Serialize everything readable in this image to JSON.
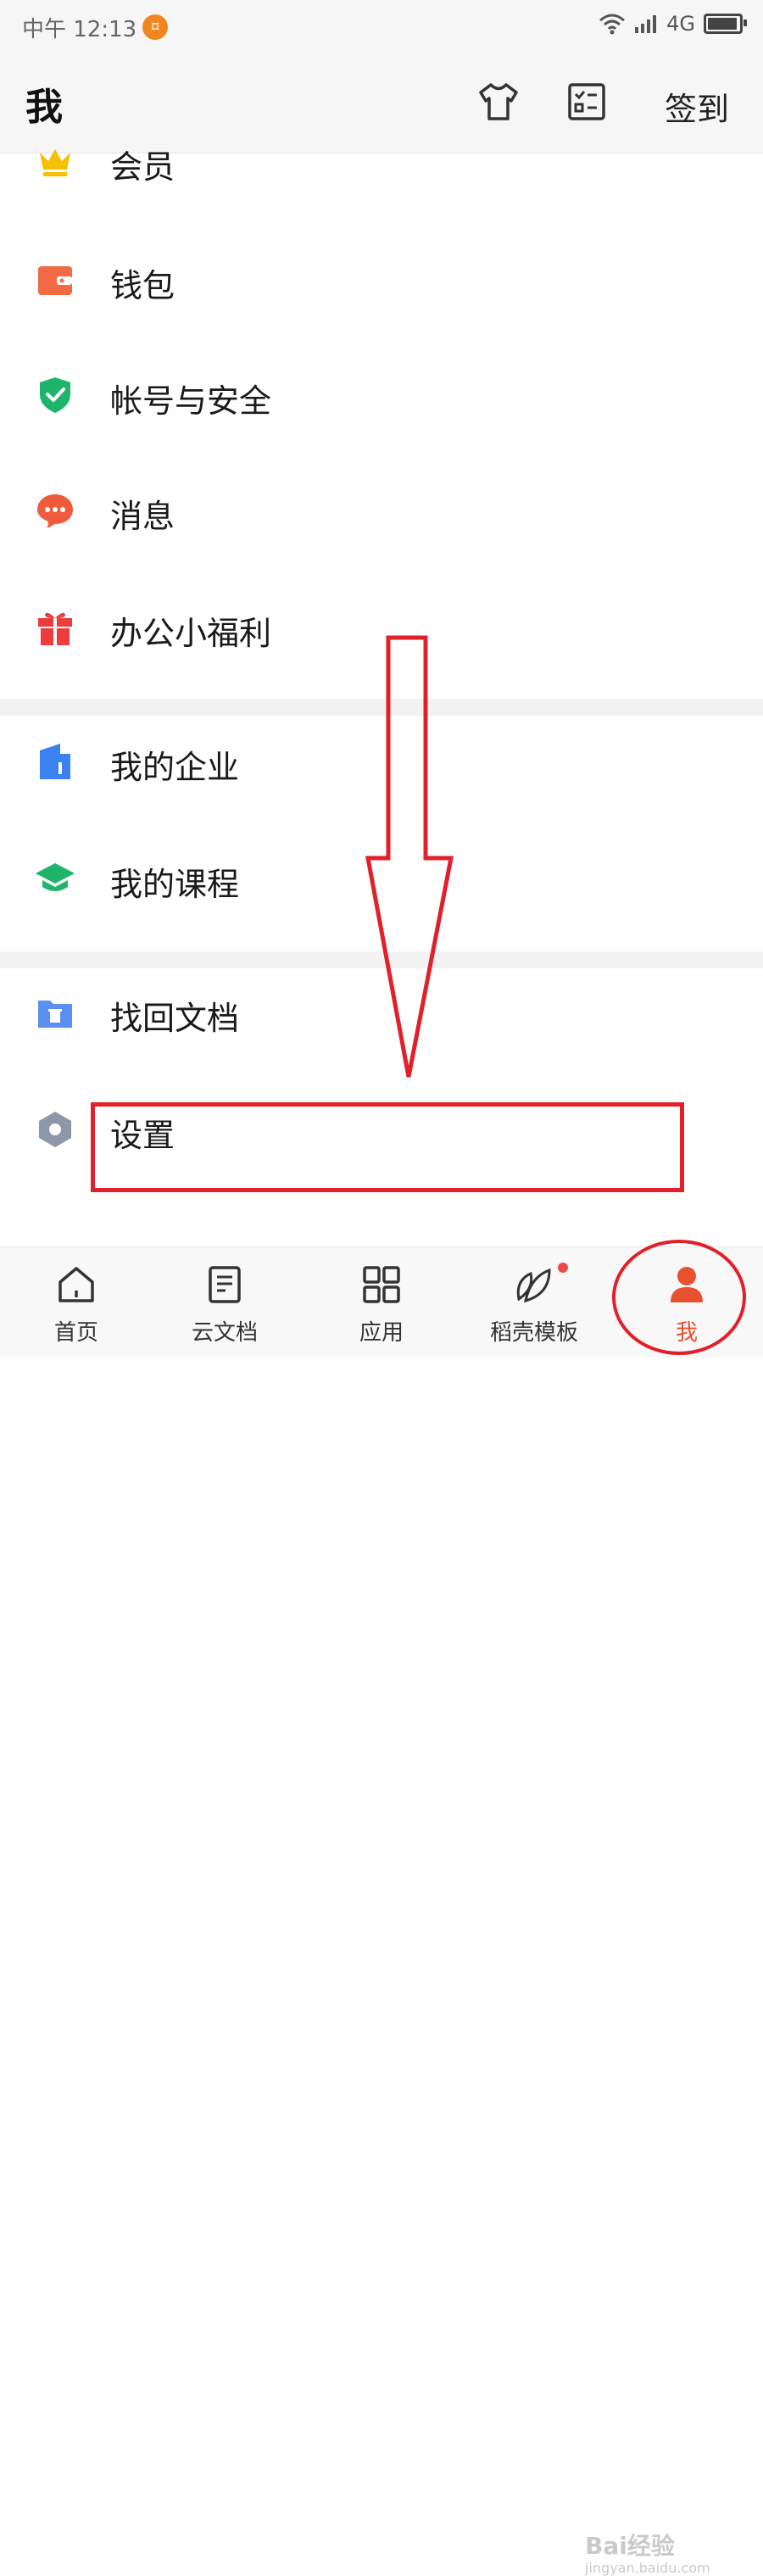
{
  "status_bar": {
    "time": "中午 12:13",
    "app_badge": "⌑",
    "network": "4G"
  },
  "header": {
    "title": "我",
    "checkin_label": "签到"
  },
  "menu": {
    "items": [
      {
        "label": "会员",
        "icon": "crown-icon",
        "color": "#f5c000"
      },
      {
        "label": "钱包",
        "icon": "wallet-icon",
        "color": "#f26a43"
      },
      {
        "label": "帐号与安全",
        "icon": "shield-check-icon",
        "color": "#1fb46c"
      },
      {
        "label": "消息",
        "icon": "message-icon",
        "color": "#ef5b3c"
      },
      {
        "label": "办公小福利",
        "icon": "gift-icon",
        "color": "#ee3b3b"
      },
      {
        "label": "我的企业",
        "icon": "enterprise-icon",
        "color": "#3b82f0"
      },
      {
        "label": "我的课程",
        "icon": "graduation-cap-icon",
        "color": "#1fb46c"
      },
      {
        "label": "找回文档",
        "icon": "recover-folder-icon",
        "color": "#5b8ff0"
      },
      {
        "label": "设置",
        "icon": "settings-icon",
        "color": "#8e97a8"
      }
    ]
  },
  "tabbar": {
    "tabs": [
      {
        "label": "首页",
        "icon": "home-icon"
      },
      {
        "label": "云文档",
        "icon": "document-icon"
      },
      {
        "label": "应用",
        "icon": "apps-grid-icon"
      },
      {
        "label": "稻壳模板",
        "icon": "leaf-icon"
      },
      {
        "label": "我",
        "icon": "person-icon",
        "active": true
      }
    ]
  },
  "watermark": {
    "brand": "Bai经验",
    "url": "jingyan.baidu.com"
  },
  "colors": {
    "accent": "#e8512f",
    "annotation": "#e0202b"
  }
}
